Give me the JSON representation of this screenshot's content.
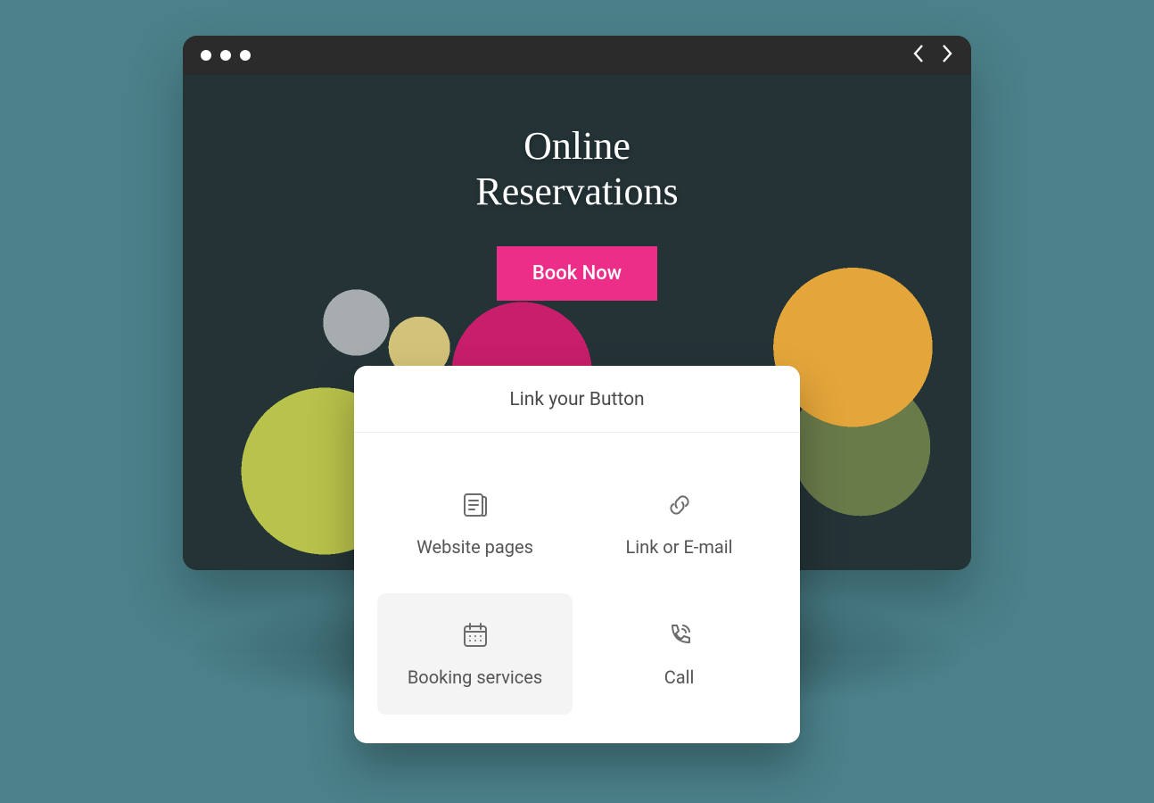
{
  "hero": {
    "title_line1": "Online",
    "title_line2": "Reservations",
    "cta_label": "Book Now"
  },
  "popup": {
    "title": "Link your Button",
    "options": [
      {
        "key": "website-pages",
        "icon": "pages-icon",
        "label": "Website pages",
        "selected": false
      },
      {
        "key": "link-or-email",
        "icon": "link-icon",
        "label": "Link or E-mail",
        "selected": false
      },
      {
        "key": "booking-services",
        "icon": "calendar-icon",
        "label": "Booking services",
        "selected": true
      },
      {
        "key": "call",
        "icon": "phone-icon",
        "label": "Call",
        "selected": false
      }
    ]
  },
  "colors": {
    "accent": "#ec2e89",
    "page_bg": "#4b818a",
    "titlebar": "#2b2b2b"
  }
}
